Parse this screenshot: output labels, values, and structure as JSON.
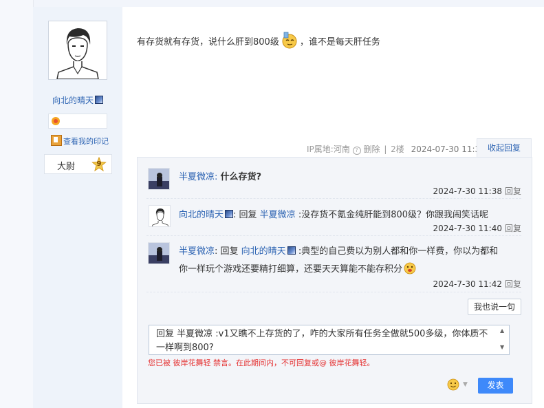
{
  "author": {
    "name": "向北的晴天",
    "imprint_label": "查看我的印记",
    "level_title": "大尉",
    "level_number": "9"
  },
  "post": {
    "text_part1": "有存货就有存货，说什么肝到800级",
    "text_part2": "，谁不是每天肝任务",
    "location": "IP属地:河南",
    "delete_label": "删除",
    "floor": "2楼",
    "timestamp": "2024-07-30 11:34",
    "collapse_label": "收起回复"
  },
  "replies": [
    {
      "user": "半夏微凉",
      "colon": ":",
      "text": "什么存货?",
      "time": "2024-7-30 11:38",
      "reply_label": "回复"
    },
    {
      "user": "向北的晴天",
      "prefix": ": 回复 ",
      "target": "半夏微凉",
      "text": " :没存货不氪金纯肝能到800级？你跟我闹笑话呢",
      "time": "2024-7-30 11:40",
      "reply_label": "回复"
    },
    {
      "user": "半夏微凉",
      "prefix": ": 回复 ",
      "target": "向北的晴天",
      "text_line1": " :典型的自己费以为别人都和你一样费，你以为都和",
      "text_line2": "你一样玩个游戏还要精打细算，还要天天算能不能存积分",
      "time": "2024-7-30 11:42",
      "reply_label": "回复"
    }
  ],
  "say_button": "我也说一句",
  "composer": {
    "value": "回复 半夏微凉 :v1又瞧不上存货的了，咋的大家所有任务全做就500多级，你体质不一样啊到800?"
  },
  "warning": "您已被 彼岸花舞轻 禁言。在此期间内，不可回复或@ 彼岸花舞轻。",
  "submit_label": "发表",
  "colors": {
    "link": "#2d64b3",
    "submit_bg": "#3e89fa",
    "warning": "#e53333"
  },
  "icons": [
    "medal-icon",
    "badge-icon",
    "imprint-icon",
    "level-star-icon",
    "question-icon",
    "emoji-icon",
    "chevron-down-icon"
  ]
}
